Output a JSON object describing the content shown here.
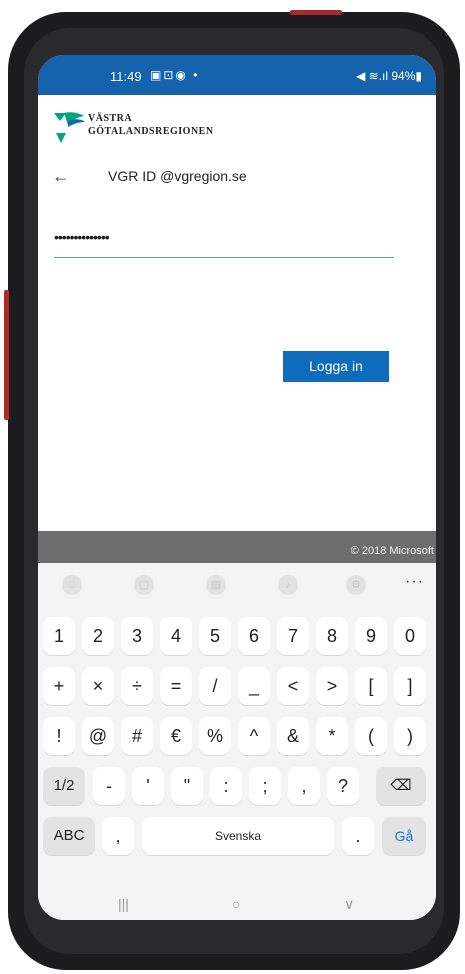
{
  "status_bar": {
    "time": "11:49",
    "left_icons": "▣⊡◉ •",
    "right": "◀ ≋.ıl 94%▮"
  },
  "logo": {
    "line1": "VÄSTRA",
    "line2": "GÖTALANDSREGIONEN"
  },
  "signin": {
    "back_glyph": "←",
    "identity": "VGR ID @vgregion.se",
    "password_mask": "••••••••••••••",
    "login_label": "Logga in"
  },
  "footer": {
    "copyright": "© 2018 Microsoft"
  },
  "keyboard": {
    "toolbar": {
      "icons": [
        "emoji-icon",
        "clipboard-icon",
        "sticker-icon",
        "microphone-icon",
        "settings-icon"
      ],
      "more": "···"
    },
    "row1": [
      "1",
      "2",
      "3",
      "4",
      "5",
      "6",
      "7",
      "8",
      "9",
      "0"
    ],
    "row2": [
      "+",
      "×",
      "÷",
      "=",
      "/",
      "_",
      "<",
      ">",
      "[",
      "]"
    ],
    "row3": [
      "!",
      "@",
      "#",
      "€",
      "%",
      "^",
      "&",
      "*",
      "(",
      ")"
    ],
    "row4": [
      "1/2",
      "-",
      "'",
      "\"",
      ":",
      ";",
      ",",
      "?",
      "⌫"
    ],
    "row5": {
      "abc": "ABC",
      "comma": ",",
      "space": "Svenska",
      "period": ".",
      "go": "Gå"
    }
  },
  "navbar": {
    "recents": "|||",
    "home": "○",
    "back": "∨"
  },
  "colors": {
    "status_bar": "#1563ad",
    "login_button": "#0f6cbd",
    "footer": "#6d6d6d",
    "go_key_text": "#1e6fd9",
    "logo_green": "#00a77d",
    "logo_blue": "#0b6ea8"
  }
}
